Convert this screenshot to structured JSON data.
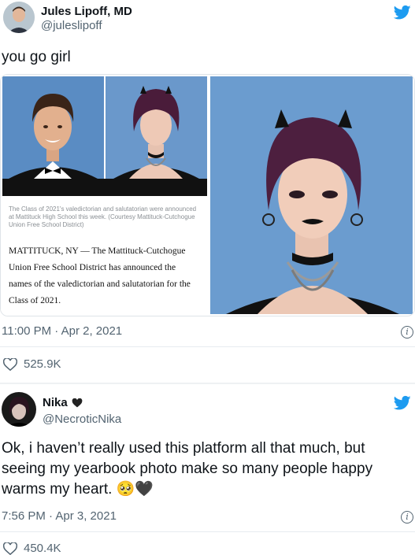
{
  "tweet1": {
    "name": "Jules Lipoff, MD",
    "handle": "@juleslipoff",
    "text": "you go girl",
    "caption": "The Class of 2021's valedictorian and salutatorian were announced at Mattituck High School this week. (Courtesy Mattituck-Cutchogue Union Free School District)",
    "article_text": "MATTITUCK, NY — The Mattituck-Cutchogue Union Free School District has announced the names of the valedictorian and salutatorian for the Class of 2021.",
    "timestamp": "11:00 PM · Apr 2, 2021",
    "likes": "525.9K"
  },
  "tweet2": {
    "name": "Nika",
    "handle": "@NecroticNika",
    "text": "Ok, i haven’t really used this platform all that much, but seeing my yearbook photo make so many people happy warms my heart.",
    "emoji": "🥺🖤",
    "timestamp": "7:56 PM · Apr 3, 2021",
    "likes": "450.4K"
  },
  "icons": {
    "brand": "twitter-bird-icon",
    "heart": "heart-outline-icon",
    "info": "info-icon",
    "verified_heart": "black-heart-icon"
  },
  "colors": {
    "twitter_blue": "#1d9bf0",
    "text": "#0f1419",
    "secondary": "#536471",
    "photo_bg": "#5d8fc4"
  }
}
